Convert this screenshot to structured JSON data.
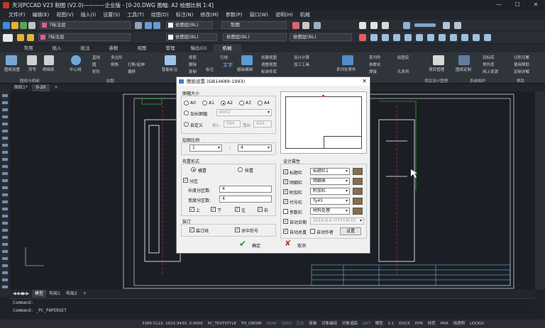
{
  "window": {
    "title": "天河PCCAD V23 制图 (V2.0)————企业版 - [0-20.DWG 图幅: A2 绘图比例 1:4]"
  },
  "menu": [
    "文件(F)",
    "编辑(E)",
    "视图(V)",
    "插入(I)",
    "设置(S)",
    "工具(T)",
    "绘图(D)",
    "标注(N)",
    "修改(M)",
    "参数(P)",
    "窗口(W)",
    "说明(H)",
    "机械"
  ],
  "toolbar": {
    "layer_combo": "7标注层",
    "bylayer_color": "依图层(BL)",
    "linetype_combo": "依图层(BL)",
    "style_combo": "制图",
    "lineweight_combo": "依图层(BL)"
  },
  "ribbon": {
    "tabs": [
      "常用",
      "插入",
      "批注",
      "参数",
      "视图",
      "管理",
      "输出(O)",
      "机械"
    ],
    "active_tab": "机械",
    "labels": [
      "图纸设置",
      "序号",
      "明细表",
      "中心线",
      "直线",
      "圆",
      "矩形",
      "多边形",
      "倒角",
      "打断/延伸",
      "偏移",
      "智能标注",
      "修剪",
      "删除",
      "复制",
      "标注",
      "引线",
      "文字",
      "超级编辑",
      "创建视图",
      "调整视图",
      "标准件库",
      "设计计算",
      "加工工具",
      "系列化零件",
      "系列件",
      "参数化",
      "焊接",
      "绘图宏",
      "孔系列",
      "项目管理",
      "项目设计管理",
      "图纸定制",
      "目标库",
      "零件库",
      "网上资源",
      "日积月累",
      "使用帮助",
      "定制详解"
    ],
    "groups": [
      "图纸与明细",
      "绘图",
      "标注",
      "项目设计管理",
      "系统维护",
      "帮助"
    ]
  },
  "doc_tabs": [
    "图纸1*",
    "0-20"
  ],
  "layout_tabs": [
    "模型",
    "布局1",
    "布局2"
  ],
  "command": {
    "line1": "Command:",
    "line2": "Command: _PC_PAPERSET"
  },
  "status": {
    "coords": "3386.5122, 1615.9430, 0.0000",
    "items": [
      "PC_TEXTSTYLE",
      "TH_GBDIM",
      "SNAP",
      "GRID",
      "正交",
      "极轴",
      "对象捕捉",
      "对象追踪",
      "LWT",
      "模型",
      "1:1",
      "DUCS",
      "DYN",
      "线宽",
      "HKA",
      "线透明",
      "LOCKUI"
    ]
  },
  "dialog": {
    "title": "图纸设置 (GB14689-1993)",
    "size_group": "图幅大小",
    "sizes": [
      "A0",
      "A1",
      "A2",
      "A3",
      "A4"
    ],
    "selected_size": "A2",
    "lengthen_label": "加长图幅",
    "lengthen_value": "A0X2",
    "custom_label": "自定义",
    "length_label": "长L:",
    "length_value": "594",
    "width_label": "宽B:",
    "width_value": "420",
    "scale_group": "绘图比例",
    "scale_a": "1",
    "scale_colon": ":",
    "scale_b": "4",
    "layout_group": "布置形式",
    "horizontal": "横置",
    "vertical": "纵置",
    "zone_label": "分区",
    "len_div_label": "长度分区数:",
    "len_div_value": "4",
    "wid_div_label": "宽度分区数:",
    "wid_div_value": "4",
    "sides": [
      "上",
      "下",
      "左",
      "右"
    ],
    "binding_group": "装订",
    "binding_line": "装订线",
    "center_mark": "对中符号",
    "design_group": "设计属性",
    "attrs": [
      {
        "label": "标题栏",
        "value": "标题栏1"
      },
      {
        "label": "明细栏",
        "value": "明细表"
      },
      {
        "label": "附加栏",
        "value": "附加栏"
      },
      {
        "label": "代号栏",
        "value": "Ty45"
      },
      {
        "label": "参数栏",
        "value": "材料处理"
      }
    ],
    "auto_date": "自动日期",
    "date_value": "2016.9.6 (YYYY.M.D)",
    "auto_total": "自动总重",
    "auto_author": "自动作者",
    "settings_btn": "设置",
    "ok": "确定",
    "cancel": "取消"
  }
}
